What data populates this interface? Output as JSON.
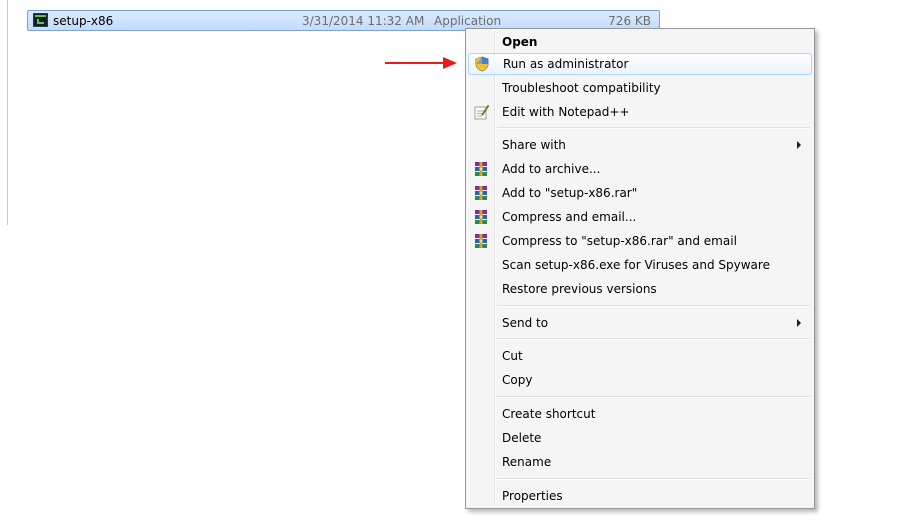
{
  "file": {
    "name": "setup-x86",
    "date_modified": "3/31/2014 11:32 AM",
    "type": "Application",
    "size": "726 KB"
  },
  "context_menu": {
    "items": [
      {
        "label": "Open",
        "bold": true,
        "icon": "",
        "submenu": false
      },
      {
        "label": "Run as administrator",
        "bold": false,
        "icon": "uac-shield-icon",
        "submenu": false,
        "highlighted": true
      },
      {
        "label": "Troubleshoot compatibility",
        "bold": false,
        "icon": "",
        "submenu": false
      },
      {
        "label": "Edit with Notepad++",
        "bold": false,
        "icon": "notepad-plus-plus-icon",
        "submenu": false
      },
      {
        "label": "Share with",
        "bold": false,
        "icon": "",
        "submenu": true
      },
      {
        "label": "Add to archive...",
        "bold": false,
        "icon": "winrar-icon",
        "submenu": false
      },
      {
        "label": "Add to \"setup-x86.rar\"",
        "bold": false,
        "icon": "winrar-icon",
        "submenu": false
      },
      {
        "label": "Compress and email...",
        "bold": false,
        "icon": "winrar-icon",
        "submenu": false
      },
      {
        "label": "Compress to \"setup-x86.rar\" and email",
        "bold": false,
        "icon": "winrar-icon",
        "submenu": false
      },
      {
        "label": "Scan setup-x86.exe for Viruses and Spyware",
        "bold": false,
        "icon": "",
        "submenu": false
      },
      {
        "label": "Restore previous versions",
        "bold": false,
        "icon": "",
        "submenu": false
      },
      {
        "label": "Send to",
        "bold": false,
        "icon": "",
        "submenu": true
      },
      {
        "label": "Cut",
        "bold": false,
        "icon": "",
        "submenu": false
      },
      {
        "label": "Copy",
        "bold": false,
        "icon": "",
        "submenu": false
      },
      {
        "label": "Create shortcut",
        "bold": false,
        "icon": "",
        "submenu": false
      },
      {
        "label": "Delete",
        "bold": false,
        "icon": "",
        "submenu": false
      },
      {
        "label": "Rename",
        "bold": false,
        "icon": "",
        "submenu": false
      },
      {
        "label": "Properties",
        "bold": false,
        "icon": "",
        "submenu": false
      }
    ]
  },
  "colors": {
    "selection_border": "#7da2ce",
    "hover_border": "#a8d8fb",
    "annotation_arrow": "#e81b1b"
  }
}
